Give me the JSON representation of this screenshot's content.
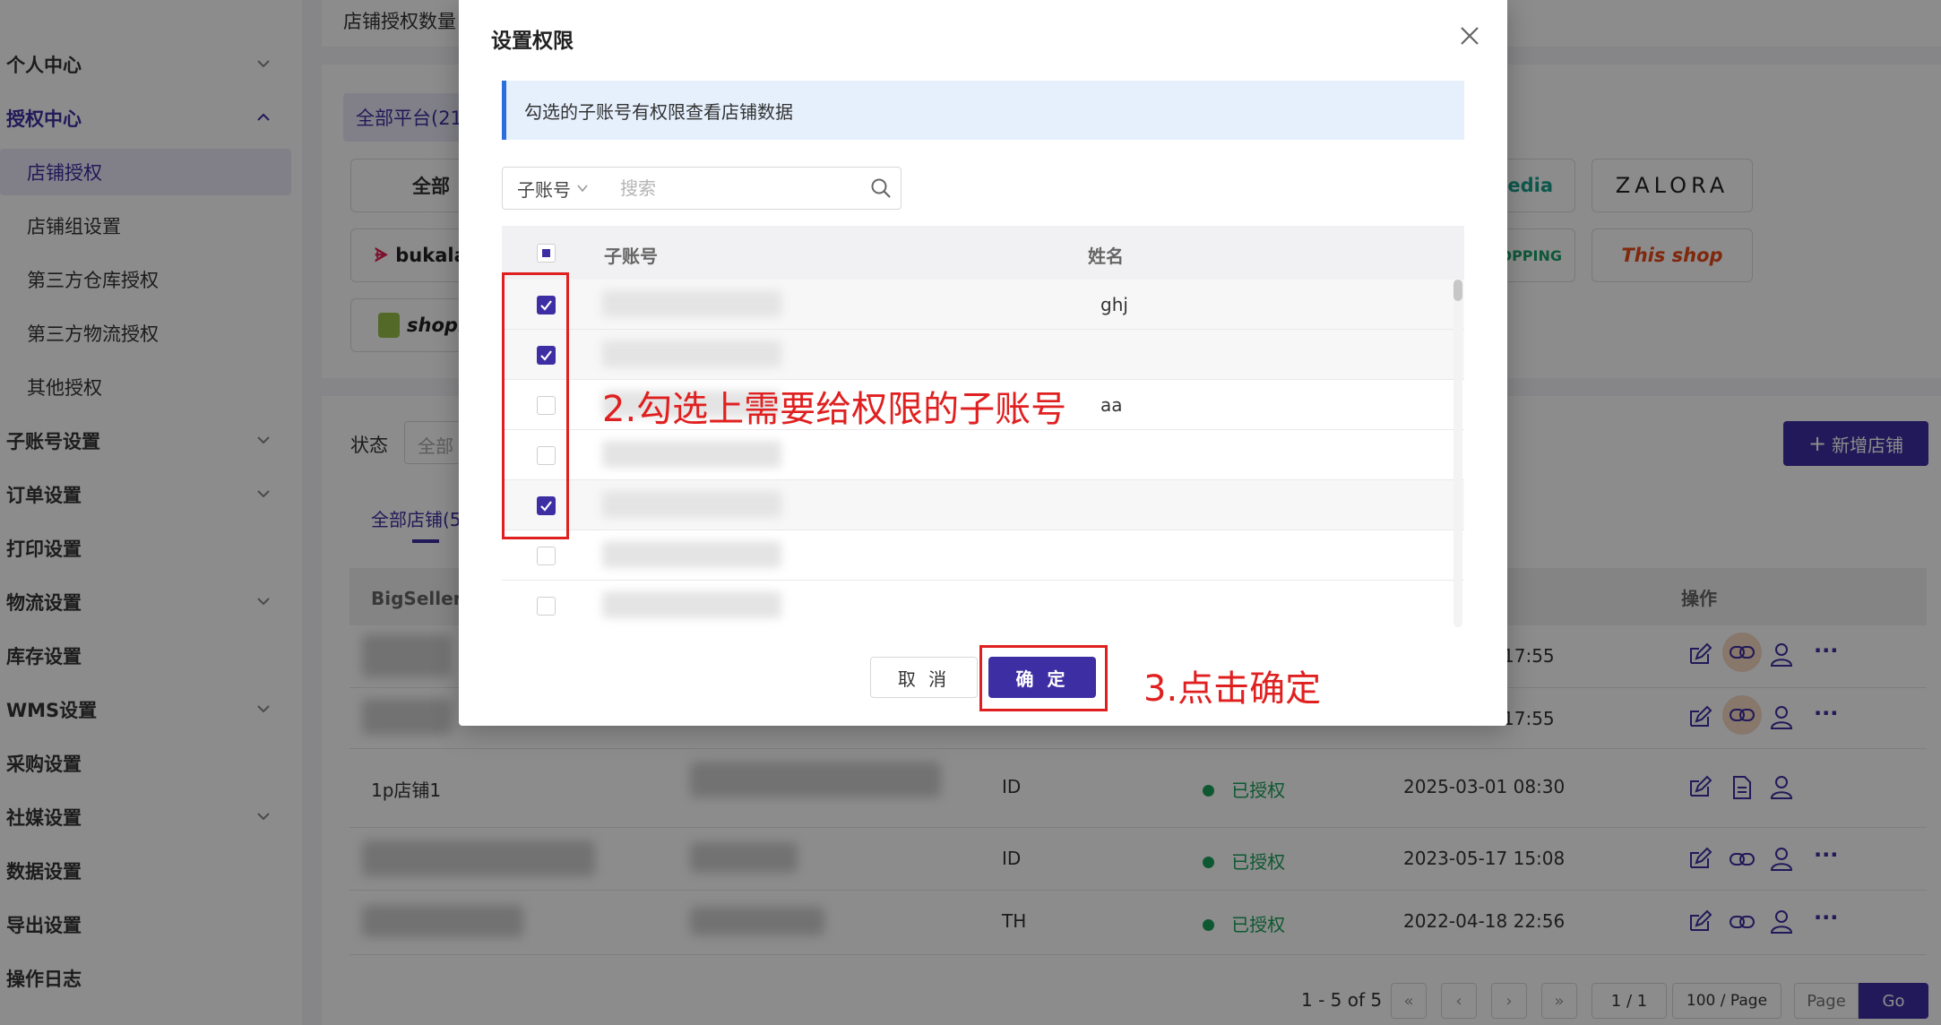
{
  "sidebar": {
    "items": [
      {
        "label": "个人中心",
        "has_chevron": true
      },
      {
        "label": "授权中心",
        "has_chevron": true
      },
      {
        "label": "店铺授权"
      },
      {
        "label": "店铺组设置"
      },
      {
        "label": "第三方仓库授权"
      },
      {
        "label": "第三方物流授权"
      },
      {
        "label": "其他授权"
      },
      {
        "label": "子账号设置",
        "has_chevron": true
      },
      {
        "label": "订单设置",
        "has_chevron": true
      },
      {
        "label": "打印设置"
      },
      {
        "label": "物流设置",
        "has_chevron": true
      },
      {
        "label": "库存设置"
      },
      {
        "label": "WMS设置",
        "has_chevron": true
      },
      {
        "label": "采购设置"
      },
      {
        "label": "社媒设置",
        "has_chevron": true
      },
      {
        "label": "数据设置"
      },
      {
        "label": "导出设置"
      },
      {
        "label": "操作日志"
      }
    ]
  },
  "main": {
    "store_auth_count_label": "店铺授权数量",
    "platform_tab": "全部平台(21",
    "platform_buttons": [
      "全部",
      "bukalap",
      "shopi",
      "pedia",
      "ZALORA",
      "OPPING",
      "This shop"
    ],
    "status_label": "状态",
    "status_select": "全部",
    "add_store_button": "新增店铺",
    "stores_tab": "全部店铺(5",
    "table": {
      "col_store": "BigSeller 店",
      "col_ops": "操作",
      "rows": [
        {
          "name": "",
          "site": "",
          "status": "",
          "time": "17:55"
        },
        {
          "name": "",
          "site": "",
          "status": "",
          "time": "17:55"
        },
        {
          "name": "1p店铺1",
          "site": "ID",
          "status": "已授权",
          "time": "2025-03-01 08:30"
        },
        {
          "name": "",
          "site": "ID",
          "status": "已授权",
          "time": "2023-05-17 15:08"
        },
        {
          "name": "",
          "site": "TH",
          "status": "已授权",
          "time": "2022-04-18 22:56"
        }
      ]
    },
    "pagination": {
      "range": "1 - 5 of 5",
      "page": "1 / 1",
      "page_size": "100 / Page",
      "page_input_placeholder": "Page",
      "go": "Go"
    }
  },
  "modal": {
    "title": "设置权限",
    "info": "勾选的子账号有权限查看店铺数据",
    "filter_select": "子账号",
    "search_placeholder": "搜索",
    "columns": {
      "account": "子账号",
      "name": "姓名"
    },
    "rows": [
      {
        "checked": true,
        "name": "ghj"
      },
      {
        "checked": true,
        "name": ""
      },
      {
        "checked": false,
        "name": "aa"
      },
      {
        "checked": false,
        "name": ""
      },
      {
        "checked": true,
        "name": ""
      },
      {
        "checked": false,
        "name": ""
      },
      {
        "checked": false,
        "name": ""
      }
    ],
    "cancel": "取 消",
    "ok": "确 定"
  },
  "annotations": {
    "step2": "2.勾选上需要给权限的子账号",
    "step3": "3.点击确定"
  },
  "colors": {
    "accent": "#3d2fa3",
    "info_bg": "#e6f0fd",
    "success": "#1aa05a",
    "annotation": "#e02020"
  }
}
